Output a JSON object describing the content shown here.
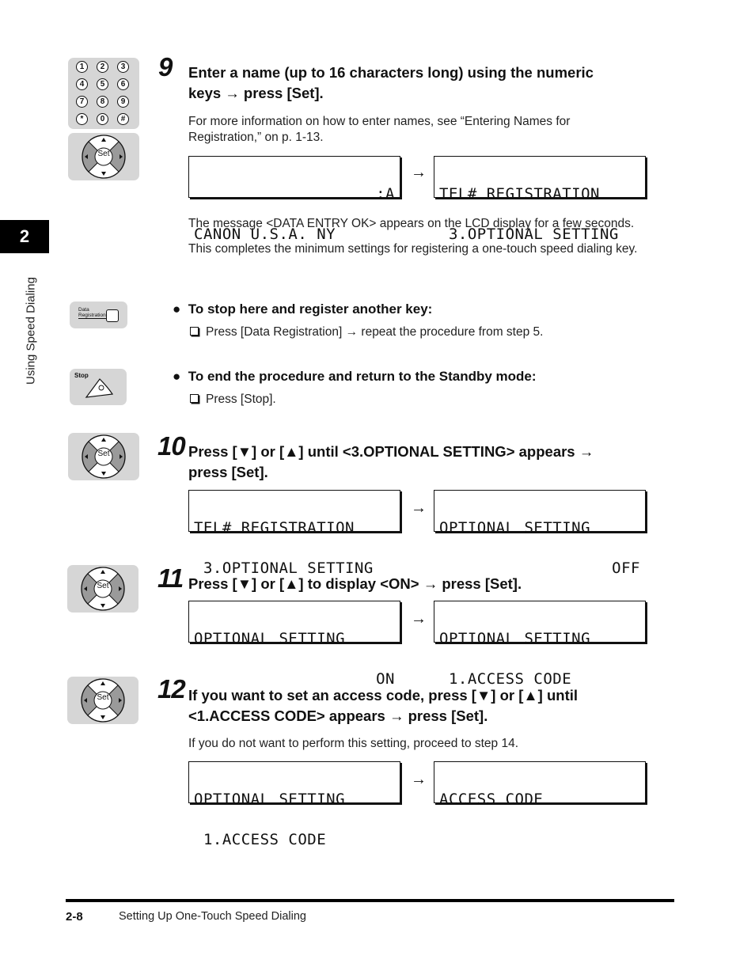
{
  "chapter": {
    "number": "2",
    "title": "Using Speed Dialing"
  },
  "icons": {
    "keypad_keys": [
      "1",
      "2",
      "3",
      "4",
      "5",
      "6",
      "7",
      "8",
      "9",
      "*",
      "0",
      "#"
    ],
    "set_label": "Set",
    "data_registration_label_line1": "Data",
    "data_registration_label_line2": "Registration",
    "stop_label": "Stop"
  },
  "steps": [
    {
      "number": "9",
      "heading_line1": "Enter a name (up to 16 characters long) using the numeric",
      "heading_line2": "keys → press [Set].",
      "note": "For more information on how to enter names, see “Entering Names for Registration,” on p. 1-13.",
      "lcd_before": {
        "line1": ":A",
        "line2": "CANON U.S.A. NY"
      },
      "lcd_after": {
        "line1": "TEL# REGISTRATION",
        "line2": " 3.OPTIONAL SETTING"
      },
      "after_paragraphs": [
        "The message <DATA ENTRY OK> appears on the LCD display for a few seconds.",
        "This completes the minimum settings for registering a one-touch speed dialing key."
      ],
      "options": [
        {
          "heading": "To stop here and register another key:",
          "instruction": "Press [Data Registration] → repeat the procedure from step 5."
        },
        {
          "heading": "To end the procedure and return to the Standby mode:",
          "instruction": "Press [Stop]."
        }
      ]
    },
    {
      "number": "10",
      "heading_line1": "Press [▼] or [▲] until <3.OPTIONAL SETTING> appears →",
      "heading_line2": "press [Set].",
      "lcd_before": {
        "line1": "TEL# REGISTRATION",
        "line2": " 3.OPTIONAL SETTING"
      },
      "lcd_after": {
        "line1": "OPTIONAL SETTING",
        "line2": "OFF"
      }
    },
    {
      "number": "11",
      "heading_line1": "Press [▼] or [▲] to display <ON> → press [Set].",
      "lcd_before": {
        "line1": "OPTIONAL SETTING",
        "line2": "ON"
      },
      "lcd_after": {
        "line1": "OPTIONAL SETTING",
        "line2": " 1.ACCESS CODE"
      }
    },
    {
      "number": "12",
      "heading_line1": "If you want to set an access code, press [▼] or [▲] until",
      "heading_line2": "<1.ACCESS CODE> appears → press [Set].",
      "note": "If you do not want to perform this setting, proceed to step 14.",
      "lcd_before": {
        "line1": "OPTIONAL SETTING",
        "line2": " 1.ACCESS CODE"
      },
      "lcd_after": {
        "line1": "ACCESS CODE",
        "line2": ""
      }
    }
  ],
  "arrow_glyph": "→",
  "footer": {
    "page": "2-8",
    "title": "Setting Up One-Touch Speed Dialing"
  }
}
